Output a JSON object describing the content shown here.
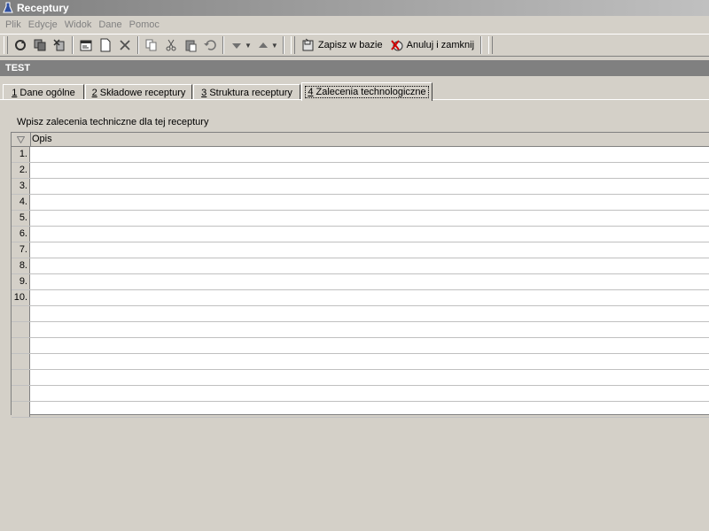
{
  "window": {
    "title": "Receptury"
  },
  "menu": [
    "Plik",
    "Edycje",
    "Widok",
    "Dane",
    "Pomoc"
  ],
  "toolbar": {
    "save_label": "Zapisz w bazie",
    "cancel_label": "Anuluj i zamknij"
  },
  "record": {
    "name": "TEST"
  },
  "tabs": [
    {
      "key": "1",
      "label": " Dane ogólne"
    },
    {
      "key": "2",
      "label": " Składowe receptury"
    },
    {
      "key": "3",
      "label": " Struktura receptury"
    },
    {
      "key": "4",
      "label": " Zalecenia technologiczne"
    }
  ],
  "hint": "Wpisz zalecenia techniczne dla tej receptury",
  "grid": {
    "column": "Opis",
    "row_numbers": [
      "1.",
      "2.",
      "3.",
      "4.",
      "5.",
      "6.",
      "7.",
      "8.",
      "9.",
      "10.",
      "",
      "",
      "",
      "",
      "",
      "",
      ""
    ]
  },
  "colors": {
    "title_gradient_start": "#808080",
    "record_bar": "#808080",
    "face": "#d4d0c8"
  }
}
